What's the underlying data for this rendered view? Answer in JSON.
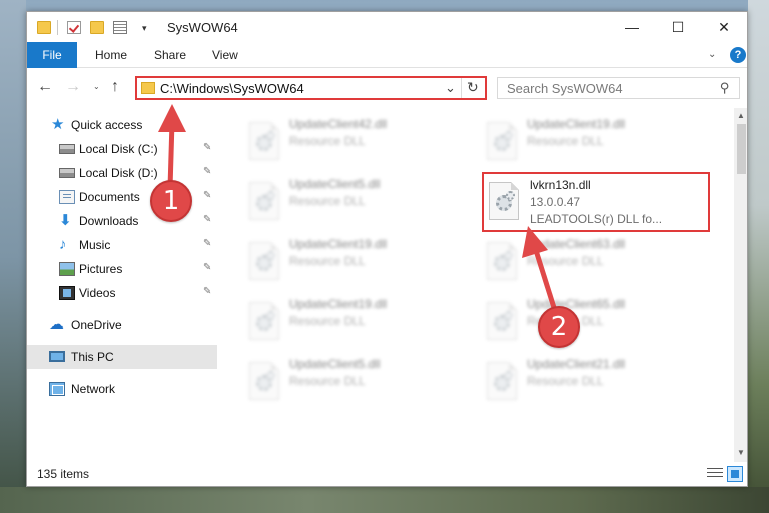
{
  "window": {
    "title": "SysWOW64",
    "minimize_glyph": "—",
    "maximize_glyph": "☐",
    "close_glyph": "✕"
  },
  "ribbon": {
    "tabs": [
      "File",
      "Home",
      "Share",
      "View"
    ],
    "collapse_glyph": "⌄",
    "help_glyph": "?"
  },
  "nav": {
    "back_glyph": "←",
    "forward_glyph": "→",
    "recent_glyph": "⌄",
    "up_glyph": "↑",
    "address": "C:\\Windows\\SysWOW64",
    "address_drop_glyph": "⌄",
    "refresh_glyph": "↻",
    "search_placeholder": "Search SysWOW64",
    "search_glyph": "⚲"
  },
  "sidebar": {
    "items": [
      {
        "label": "Quick access",
        "icon": "star-icon"
      },
      {
        "label": "Local Disk (C:)",
        "icon": "disk-icon"
      },
      {
        "label": "Local Disk (D:)",
        "icon": "disk-icon"
      },
      {
        "label": "Documents",
        "icon": "documents-icon"
      },
      {
        "label": "Downloads",
        "icon": "download-icon"
      },
      {
        "label": "Music",
        "icon": "music-icon"
      },
      {
        "label": "Pictures",
        "icon": "pictures-icon"
      },
      {
        "label": "Videos",
        "icon": "videos-icon"
      },
      {
        "label": "OneDrive",
        "icon": "cloud-icon"
      },
      {
        "label": "This PC",
        "icon": "computer-icon"
      },
      {
        "label": "Network",
        "icon": "network-icon"
      }
    ],
    "pin_glyph": "📌"
  },
  "files": [
    {
      "name": "UpdateClient42.dll",
      "desc": "Resource DLL"
    },
    {
      "name": "UpdateClient19.dll",
      "desc": "Resource DLL"
    },
    {
      "name": "UpdateClient5.dll",
      "desc": "Resource DLL"
    },
    {
      "name": "lvkrn13n.dll",
      "desc": "13.0.0.47",
      "desc2": "LEADTOOLS(r) DLL fo..."
    },
    {
      "name": "UpdateClient19.dll",
      "desc": "Resource DLL"
    },
    {
      "name": "UpdateClient63.dll",
      "desc": "Resource DLL"
    },
    {
      "name": "UpdateClient19.dll",
      "desc": "Resource DLL"
    },
    {
      "name": "UpdateClient65.dll",
      "desc": "Resource DLL"
    },
    {
      "name": "UpdateClient5.dll",
      "desc": "Resource DLL"
    },
    {
      "name": "UpdateClient21.dll",
      "desc": "Resource DLL"
    }
  ],
  "status": {
    "item_count": "135 items"
  },
  "scroll": {
    "up_glyph": "▲",
    "down_glyph": "▼"
  },
  "annotations": {
    "step1": "1",
    "step2": "2",
    "color": "#e04848"
  },
  "colors": {
    "accent": "#1979ca",
    "highlight": "#e03a3a",
    "selected": "#cce8ff"
  }
}
